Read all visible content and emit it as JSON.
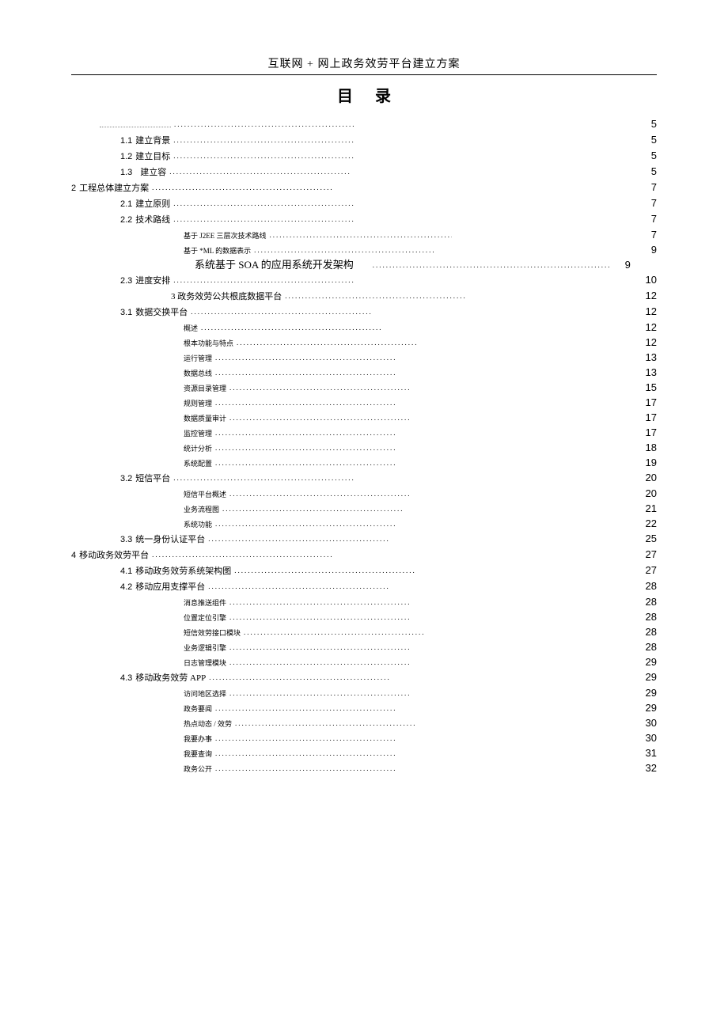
{
  "doc_title": "互联网 + 网上政务效劳平台建立方案",
  "toc_title": "目录",
  "dots": "..............................................................................................................",
  "dots_long": ".........................................................................",
  "toc": [
    {
      "level": "lvl-1",
      "num": "",
      "text": "",
      "page": "5",
      "tiny": true
    },
    {
      "level": "lvl-2",
      "num": "1.1",
      "text": "建立背景",
      "page": "5"
    },
    {
      "level": "lvl-2",
      "num": "1.2",
      "text": "建立目标",
      "page": "5"
    },
    {
      "level": "lvl-2",
      "num": "1.3",
      "text": "建立容",
      "page": "5",
      "gap": true
    },
    {
      "level": "lvl-0",
      "num": "2",
      "text": "工程总体建立方案",
      "page": "7"
    },
    {
      "level": "lvl-2",
      "num": "2.1",
      "text": "建立原则",
      "page": "7"
    },
    {
      "level": "lvl-2",
      "num": "2.2",
      "text": "技术路线",
      "page": "7"
    },
    {
      "level": "lvl-3",
      "num": "",
      "text": "基于 J2EE 三层次技术路线",
      "page": "7"
    },
    {
      "level": "lvl-3",
      "num": "",
      "text": "基于 *ML 的数据表示",
      "page": "9"
    },
    {
      "level": "lvl-3b",
      "num": "",
      "text": "系统基于  SOA 的应用系统开发架构",
      "page": "9",
      "inline_dots": true
    },
    {
      "level": "lvl-2",
      "num": "2.3",
      "text": "进度安排",
      "page": "10"
    },
    {
      "level": "lvl-3c",
      "num": "",
      "text": "3 政务效劳公共根底数据平台",
      "page": "12"
    },
    {
      "level": "lvl-2",
      "num": "3.1",
      "text": "数据交换平台",
      "page": "12"
    },
    {
      "level": "lvl-3",
      "num": "",
      "text": "概述",
      "page": "12"
    },
    {
      "level": "lvl-3",
      "num": "",
      "text": "根本功能与特点",
      "page": "12"
    },
    {
      "level": "lvl-3",
      "num": "",
      "text": "运行管理",
      "page": "13"
    },
    {
      "level": "lvl-3",
      "num": "",
      "text": "数据总线",
      "page": "13"
    },
    {
      "level": "lvl-3",
      "num": "",
      "text": "资源目录管理",
      "page": "15"
    },
    {
      "level": "lvl-3",
      "num": "",
      "text": "规则管理",
      "page": "17"
    },
    {
      "level": "lvl-3",
      "num": "",
      "text": "数据质量审计",
      "page": "17"
    },
    {
      "level": "lvl-3",
      "num": "",
      "text": "监控管理",
      "page": "17"
    },
    {
      "level": "lvl-3",
      "num": "",
      "text": "统计分析",
      "page": "18"
    },
    {
      "level": "lvl-3",
      "num": "",
      "text": "系统配置",
      "page": "19"
    },
    {
      "level": "lvl-2",
      "num": "3.2",
      "text": "短信平台",
      "page": "20"
    },
    {
      "level": "lvl-3",
      "num": "",
      "text": "短信平台概述",
      "page": "20"
    },
    {
      "level": "lvl-3",
      "num": "",
      "text": "业务流程图",
      "page": "21"
    },
    {
      "level": "lvl-3",
      "num": "",
      "text": "系统功能",
      "page": "22"
    },
    {
      "level": "lvl-2",
      "num": "3.3",
      "text": "统一身份认证平台",
      "page": "25"
    },
    {
      "level": "lvl-0",
      "num": "4",
      "text": "移动政务效劳平台",
      "page": "27"
    },
    {
      "level": "lvl-2",
      "num": "4.1",
      "text": "移动政务效劳系统架构图",
      "page": "27"
    },
    {
      "level": "lvl-2",
      "num": "4.2",
      "text": "移动应用支撑平台",
      "page": "28"
    },
    {
      "level": "lvl-3",
      "num": "",
      "text": "消息推送组件",
      "page": "28"
    },
    {
      "level": "lvl-3",
      "num": "",
      "text": "位置定位引擎",
      "page": "28"
    },
    {
      "level": "lvl-3",
      "num": "",
      "text": "短信效劳接口模块",
      "page": "28"
    },
    {
      "level": "lvl-3",
      "num": "",
      "text": "业务逻辑引擎",
      "page": "28"
    },
    {
      "level": "lvl-3",
      "num": "",
      "text": "日志管理模块",
      "page": "29"
    },
    {
      "level": "lvl-2",
      "num": "4.3",
      "text": "移动政务效劳  APP",
      "page": "29"
    },
    {
      "level": "lvl-3",
      "num": "",
      "text": "访问地区选择",
      "page": "29"
    },
    {
      "level": "lvl-3",
      "num": "",
      "text": "政务要闻",
      "page": "29"
    },
    {
      "level": "lvl-3",
      "num": "",
      "text": "热点动态 / 效劳",
      "page": "30"
    },
    {
      "level": "lvl-3",
      "num": "",
      "text": "我要办事",
      "page": "30"
    },
    {
      "level": "lvl-3",
      "num": "",
      "text": "我要查询",
      "page": "31"
    },
    {
      "level": "lvl-3",
      "num": "",
      "text": "政务公开",
      "page": "32"
    }
  ]
}
